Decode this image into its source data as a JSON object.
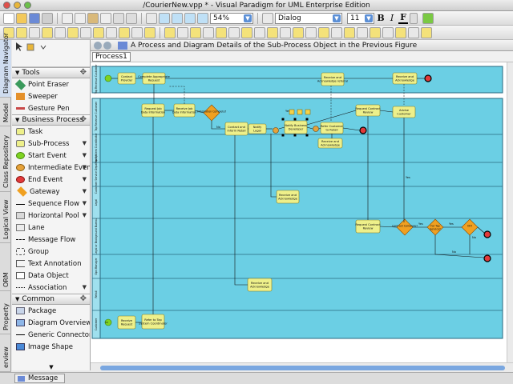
{
  "window": {
    "title": "/CourierNew.vpp * - Visual Paradigm for UML Enterprise Edition"
  },
  "toolbar": {
    "zoom": "54%",
    "font_name": "Dialog",
    "font_size": "11",
    "bold": "B",
    "italic": "I",
    "font_color": "F"
  },
  "side_tabs": [
    "Diagram Navigator",
    "Model",
    "Class Repository",
    "Logical View",
    "ORM",
    "Property",
    "erview"
  ],
  "palette": {
    "tools_header": "Tools",
    "tools": [
      "Point Eraser",
      "Sweeper",
      "Gesture Pen"
    ],
    "business_header": "Business Process",
    "business": [
      "Task",
      "Sub-Process",
      "Start Event",
      "Intermediate Event",
      "End Event",
      "Gateway",
      "Sequence Flow",
      "Horizontal Pool",
      "Lane",
      "Message Flow",
      "Group",
      "Text Annotation",
      "Data Object",
      "Association"
    ],
    "common_header": "Common",
    "common": [
      "Package",
      "Diagram Overview",
      "Generic Connector",
      "Image Shape"
    ]
  },
  "diagram": {
    "title": "A Process and Diagram Details of the Sub-Process Object in the Previous Figure",
    "breadcrumb": "Process1"
  },
  "bpmn": {
    "lanes": [
      "Tap Revenue Customer",
      "Tap System Coordinator",
      "Customer Service Department",
      "Legal",
      "Legal or Background Bureau",
      "Ops Manager",
      "Retail",
      "Customer"
    ],
    "tasks": [
      {
        "id": "t1",
        "label": "Contact Provider"
      },
      {
        "id": "t2",
        "label": "Complete Appropriate Request"
      },
      {
        "id": "t3",
        "label": "Request Job Data Information"
      },
      {
        "id": "t4",
        "label": "Receive Job Data Information"
      },
      {
        "id": "t5",
        "label": "Contact and Inform Retail"
      },
      {
        "id": "t6",
        "label": "Notify Legal"
      },
      {
        "id": "t7",
        "label": "Notify Business Developer"
      },
      {
        "id": "t8",
        "label": "Refer Customer to Retail"
      },
      {
        "id": "t9",
        "label": "Receive and Acknowledge referral"
      },
      {
        "id": "t10",
        "label": "Receive and Acknowledge"
      },
      {
        "id": "t11",
        "label": "Request Contract Review"
      },
      {
        "id": "t12",
        "label": "Advise Customer"
      },
      {
        "id": "t13",
        "label": "Receive and Acknowledge"
      },
      {
        "id": "t14",
        "label": "Receive and Acknowledge"
      },
      {
        "id": "t15",
        "label": "Request Contract Review"
      },
      {
        "id": "t16",
        "label": "Receive and Acknowledge"
      },
      {
        "id": "t17",
        "label": "Receive Request"
      },
      {
        "id": "t18",
        "label": "Refer to Tap System Coordinator"
      }
    ],
    "gateways": [
      {
        "id": "g1",
        "label": "Information Complete?"
      },
      {
        "id": "g2",
        "label": "Contract Complete?"
      },
      {
        "id": "g3",
        "label": "For Tap Service?"
      },
      {
        "id": "g4",
        "label": "OK?"
      }
    ],
    "flow_labels": {
      "yes": "Yes",
      "no": "No",
      "yes_cap": "Yes",
      "no_cap": "No"
    }
  },
  "bottom": {
    "message_tab": "Message"
  },
  "colors": {
    "pool_fill": "#6bcfe4",
    "task_fill": "#eef08a",
    "gateway_fill": "#f0a020",
    "start_event": "#7ed321",
    "end_event": "#e23a3a",
    "accent": "#5b8fd6"
  }
}
